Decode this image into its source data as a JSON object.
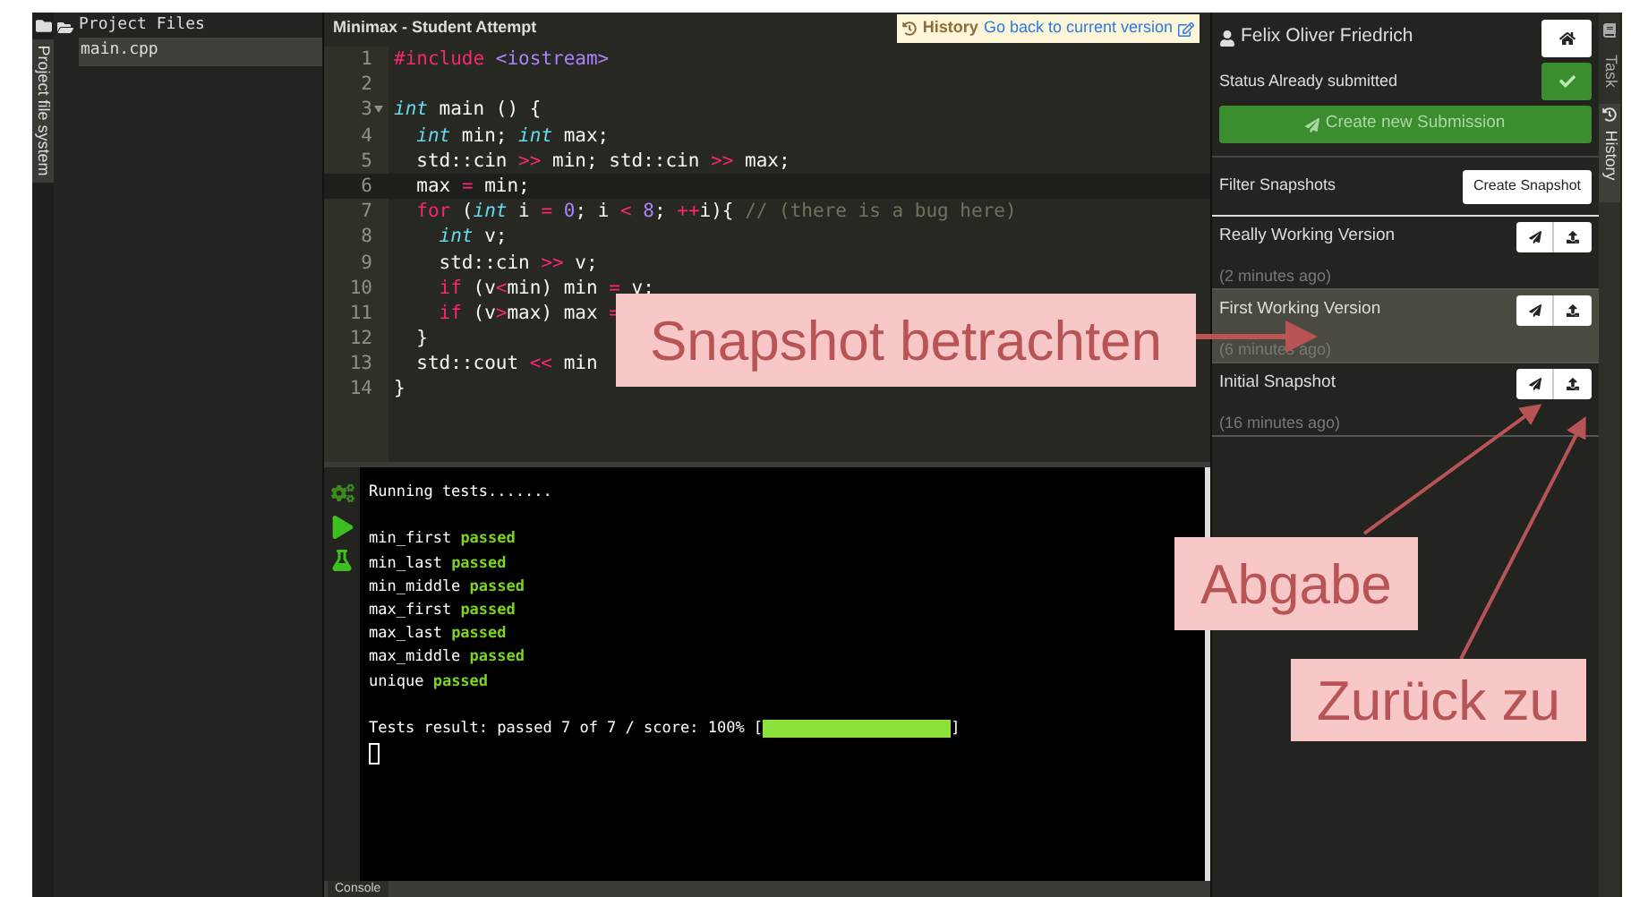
{
  "left_strip": {
    "tab_label": "Project file system"
  },
  "file_tree": {
    "root": "Project Files",
    "files": [
      {
        "name": "main.cpp",
        "selected": true
      }
    ]
  },
  "editor": {
    "title": "Minimax - Student Attempt",
    "history_badge": {
      "label": "History",
      "link": "Go back to current version"
    },
    "lines": [
      {
        "number": "1",
        "fold": false,
        "active": false,
        "tokens": [
          {
            "text": "#include ",
            "kind": "keyword"
          },
          {
            "text": "<iostream>",
            "kind": "string"
          }
        ]
      },
      {
        "number": "2",
        "fold": false,
        "active": false
      },
      {
        "number": "3",
        "fold": true,
        "active": false,
        "tokens": [
          {
            "text": "int",
            "kind": "type"
          },
          {
            "text": " main () {",
            "kind": "plain"
          }
        ]
      },
      {
        "number": "4",
        "fold": false,
        "active": false,
        "tokens": [
          {
            "text": "  int",
            "kind": "type"
          },
          {
            "text": " min; ",
            "kind": "plain"
          },
          {
            "text": "int",
            "kind": "type"
          },
          {
            "text": " max;",
            "kind": "plain"
          }
        ]
      },
      {
        "number": "5",
        "fold": false,
        "active": false,
        "tokens": [
          {
            "text": "  std::cin ",
            "kind": "plain"
          },
          {
            "text": ">>",
            "kind": "op"
          },
          {
            "text": " min; std::cin ",
            "kind": "plain"
          },
          {
            "text": ">>",
            "kind": "op"
          },
          {
            "text": " max;",
            "kind": "plain"
          }
        ]
      },
      {
        "number": "6",
        "fold": false,
        "active": true,
        "tokens": [
          {
            "text": "  max ",
            "kind": "plain"
          },
          {
            "text": "=",
            "kind": "op"
          },
          {
            "text": " min;",
            "kind": "plain"
          }
        ]
      },
      {
        "number": "7",
        "fold": false,
        "active": false,
        "tokens": [
          {
            "text": "  for",
            "kind": "keyword"
          },
          {
            "text": " (",
            "kind": "plain"
          },
          {
            "text": "int",
            "kind": "type"
          },
          {
            "text": " i ",
            "kind": "plain"
          },
          {
            "text": "=",
            "kind": "op"
          },
          {
            "text": " 0",
            "kind": "number"
          },
          {
            "text": "; i ",
            "kind": "plain"
          },
          {
            "text": "<",
            "kind": "op"
          },
          {
            "text": " 8",
            "kind": "number"
          },
          {
            "text": "; ",
            "kind": "plain"
          },
          {
            "text": "++",
            "kind": "op"
          },
          {
            "text": "i){ ",
            "kind": "plain"
          },
          {
            "text": "// (there is a bug here)",
            "kind": "comment"
          }
        ]
      },
      {
        "number": "8",
        "fold": false,
        "active": false,
        "tokens": [
          {
            "text": "    int",
            "kind": "type"
          },
          {
            "text": " v;",
            "kind": "plain"
          }
        ]
      },
      {
        "number": "9",
        "fold": false,
        "active": false,
        "tokens": [
          {
            "text": "    std::cin ",
            "kind": "plain"
          },
          {
            "text": ">>",
            "kind": "op"
          },
          {
            "text": " v;",
            "kind": "plain"
          }
        ]
      },
      {
        "number": "10",
        "fold": false,
        "active": false,
        "tokens": [
          {
            "text": "    if",
            "kind": "keyword"
          },
          {
            "text": " (v",
            "kind": "plain"
          },
          {
            "text": "<",
            "kind": "op"
          },
          {
            "text": "min) min ",
            "kind": "plain"
          },
          {
            "text": "=",
            "kind": "op"
          },
          {
            "text": " v;",
            "kind": "plain"
          }
        ]
      },
      {
        "number": "11",
        "fold": false,
        "active": false,
        "tokens": [
          {
            "text": "    if",
            "kind": "keyword"
          },
          {
            "text": " (v",
            "kind": "plain"
          },
          {
            "text": ">",
            "kind": "op"
          },
          {
            "text": "max) max ",
            "kind": "plain"
          },
          {
            "text": "=",
            "kind": "op"
          }
        ]
      },
      {
        "number": "12",
        "fold": false,
        "active": false,
        "tokens": [
          {
            "text": "  }",
            "kind": "plain"
          }
        ]
      },
      {
        "number": "13",
        "fold": false,
        "active": false,
        "tokens": [
          {
            "text": "  std::cout ",
            "kind": "plain"
          },
          {
            "text": "<<",
            "kind": "op"
          },
          {
            "text": " min",
            "kind": "plain"
          }
        ]
      },
      {
        "number": "14",
        "fold": false,
        "active": false,
        "tokens": [
          {
            "text": "}",
            "kind": "plain"
          }
        ]
      }
    ]
  },
  "console": {
    "lines": [
      {
        "tokens": [
          {
            "text": "Running tests.......",
            "kind": "plain"
          }
        ]
      },
      {
        "tokens": [
          {
            "text": "min_first ",
            "kind": "plain"
          },
          {
            "text": "passed",
            "kind": "pass"
          }
        ]
      },
      {
        "tokens": [
          {
            "text": "min_last ",
            "kind": "plain"
          },
          {
            "text": "passed",
            "kind": "pass"
          }
        ]
      },
      {
        "tokens": [
          {
            "text": "min_middle ",
            "kind": "plain"
          },
          {
            "text": "passed",
            "kind": "pass"
          }
        ]
      },
      {
        "tokens": [
          {
            "text": "max_first ",
            "kind": "plain"
          },
          {
            "text": "passed",
            "kind": "pass"
          }
        ]
      },
      {
        "tokens": [
          {
            "text": "max_last ",
            "kind": "plain"
          },
          {
            "text": "passed",
            "kind": "pass"
          }
        ]
      },
      {
        "tokens": [
          {
            "text": "max_middle ",
            "kind": "plain"
          },
          {
            "text": "passed",
            "kind": "pass"
          }
        ]
      },
      {
        "tokens": [
          {
            "text": "unique ",
            "kind": "plain"
          },
          {
            "text": "passed",
            "kind": "pass"
          }
        ]
      }
    ],
    "result": {
      "text": "Tests result: passed 7 of 7 / score: 100% [",
      "close": "]",
      "level": 1
    },
    "tab_label": "Console"
  },
  "side_panel": {
    "user": "Felix Oliver Friedrich",
    "status_label": "Status Already submitted",
    "submitted": true,
    "submit_button": "Create new Submission",
    "filter_label": "Filter Snapshots",
    "create_snapshot": "Create Snapshot",
    "snapshots": [
      {
        "name": "Really Working Version",
        "time": "(2 minutes ago)",
        "selected": false
      },
      {
        "name": "First Working Version",
        "time": "(6 minutes ago)",
        "selected": true
      },
      {
        "name": "Initial Snapshot",
        "time": "(16 minutes ago)",
        "selected": false
      }
    ]
  },
  "right_tabs": [
    {
      "label": "Task",
      "selected": false
    },
    {
      "label": "History",
      "selected": true
    }
  ],
  "annotations": [
    {
      "text": "Snapshot betrachten"
    },
    {
      "text": "Abgabe"
    },
    {
      "text": "Zurück zu"
    }
  ]
}
